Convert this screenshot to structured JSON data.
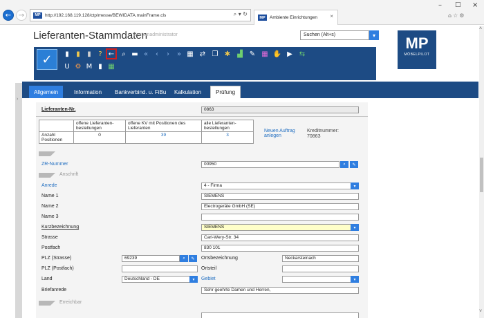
{
  "browser": {
    "url": "http://192.168.119.128/ctp/messe/BEWIDATA.mainFrame.cls",
    "favicon_text": "MP",
    "address_icons": "⌕ ▾ ↻",
    "tab_title": "Ambiente Einrichtungen",
    "tab_close": "×",
    "window_controls": [
      "–",
      "□",
      "×"
    ],
    "toolbar_glyphs": "⌂☆⚙"
  },
  "app": {
    "title": "Lieferanten-Stammdaten",
    "role": "Systemadministrator",
    "search_placeholder": "Suchen (Alt+s)",
    "logo_text": "MP",
    "logo_subtext": "MÖBELPILOT"
  },
  "toolbar": {
    "row1_icons": [
      "document-icon",
      "notes-icon",
      "trash-icon",
      "help-icon",
      "back-arrow-icon",
      "search-icon",
      "print-icon",
      "first-icon",
      "prev-icon",
      "next-icon",
      "last-icon",
      "table-icon",
      "link-icon",
      "copy-icon",
      "settings-icon",
      "chart-icon",
      "edit-icon",
      "calendar-icon",
      "info-icon",
      "export-icon",
      "transfer-icon"
    ],
    "row2_letters": [
      "U",
      "M"
    ],
    "row2_icons": [
      "settings-gear-icon",
      "document-small-icon",
      "grid-icon"
    ]
  },
  "tabs": [
    {
      "label": "Allgemein",
      "active": true
    },
    {
      "label": "Information",
      "active": false
    },
    {
      "label": "Bankverbind. u. FiBu",
      "active": false
    },
    {
      "label": "Kalkulation",
      "active": false
    },
    {
      "label": "Prüfung",
      "active": false
    }
  ],
  "form": {
    "lieferanten_nr_label": "Lieferanten-Nr.",
    "lieferanten_nr": "0863",
    "kv_table": {
      "headers": [
        "offene Lieferanten-bestellungen",
        "offene KV mit Positionen des Lieferanten",
        "alle Lieferanten-bestellungen"
      ],
      "row_label": "Anzahl Positionen",
      "values": [
        "0",
        "39",
        "3"
      ]
    },
    "neuer_auftrag": "Neuen Auftrag anlegen",
    "kreditornummer_label": "Kreditnummer:",
    "kreditornummer": "70863",
    "zr_label": "ZR-Nummer",
    "zr_value": "00950",
    "section_anschrift": "Anschrift",
    "section_erreichbar": "Erreichbar",
    "fields": [
      {
        "label": "Anrede",
        "value": "4 - Firma",
        "link": true
      },
      {
        "label": "Name 1",
        "value": "SIEMENS"
      },
      {
        "label": "Name 2",
        "value": "Electrogeräte GmbH (SE)"
      },
      {
        "label": "Name 3",
        "value": ""
      },
      {
        "label": "Kurzbezeichnung",
        "value": "SIEMENS"
      },
      {
        "label": "Strasse",
        "value": "Carl-Wery-Str. 34"
      },
      {
        "label": "Postfach",
        "value": "830 101"
      }
    ],
    "plz_strasse_label": "PLZ (Strasse)",
    "plz_strasse": "69239",
    "ortsbezeichnung_label": "Ortsbezeichnung",
    "ortsbezeichnung": "Neckarsteinach",
    "plz_postfach_label": "PLZ (Postfach)",
    "ortsteil_label": "Ortsteil",
    "land_label": "Land",
    "land_value": "Deutschland - DE",
    "gebiet_label": "Gebiet",
    "briefanrede_label": "Briefanrede",
    "briefanrede": "Sehr geehrte Damen und Herren,"
  },
  "colors": {
    "toolbar_bg": "#1d4b84",
    "accent": "#2f7ee0",
    "highlight_field": "#ffffc8",
    "highlight_border": "#d02020"
  }
}
